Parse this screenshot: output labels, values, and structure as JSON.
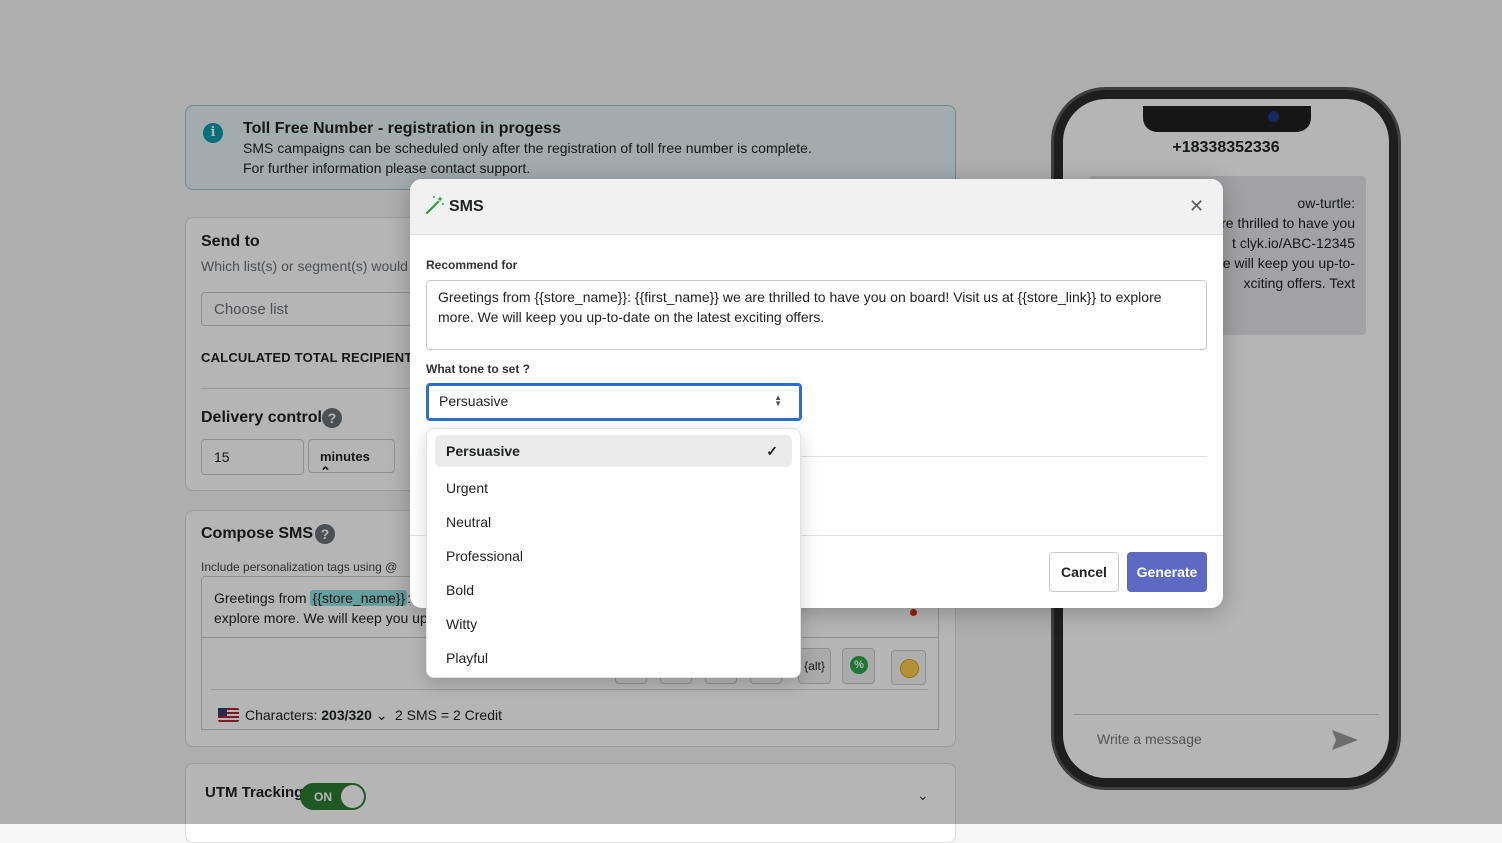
{
  "banner": {
    "title": "Toll Free Number - registration in progess",
    "line1": "SMS campaigns can be scheduled only after the registration of toll free number is complete.",
    "line2": "For further information please contact support."
  },
  "send_to": {
    "title": "Send to",
    "subtitle": "Which list(s) or segment(s) would",
    "placeholder": "Choose list",
    "recipients_label": "CALCULATED TOTAL RECIPIENTS"
  },
  "delivery": {
    "title": "Delivery control",
    "quantity": "15",
    "unit": "minutes"
  },
  "compose": {
    "title": "Compose SMS",
    "hint": "Include personalization tags using @",
    "line1_prefix": "Greetings from ",
    "line1_tag": "{{store_name}}",
    "line1_suffix": ":",
    "line2": "explore more. We will keep you up-",
    "alt_label": "{alt}",
    "discount_icon": "%",
    "characters_label": "Characters: ",
    "characters_value": "203/320",
    "credit": "2 SMS = 2 Credit"
  },
  "utm": {
    "title": "UTM Tracking",
    "toggle": "ON"
  },
  "phone": {
    "number": "+18338352336",
    "bubble_lines": [
      "ow-turtle:",
      "re thrilled to have you",
      "t clyk.io/ABC-12345",
      "e will keep you up-to-",
      "xciting offers. Text"
    ],
    "input_placeholder": "Write a message"
  },
  "modal": {
    "title": "SMS",
    "recommend_label": "Recommend for",
    "recommend_text": "Greetings from {{store_name}}: {{first_name}} we are thrilled to have you on board! Visit us at {{store_link}} to explore more. We will keep you up-to-date on the latest exciting offers.",
    "tone_label": "What tone to set ?",
    "tone_value": "Persuasive",
    "cancel": "Cancel",
    "generate": "Generate"
  },
  "tone_options": [
    "Persuasive",
    "Urgent",
    "Neutral",
    "Professional",
    "Bold",
    "Witty",
    "Playful"
  ],
  "colors": {
    "accent": "#5c6ac4",
    "focus": "#2c6ecb",
    "toggle_on": "#2e7d32",
    "banner_bg": "#e4f3f5"
  }
}
